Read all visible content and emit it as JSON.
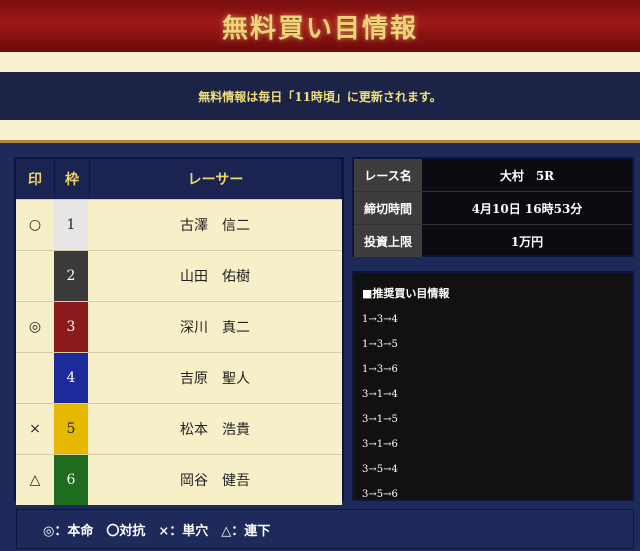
{
  "banner": {
    "title": "無料買い目情報"
  },
  "notice": {
    "text": "無料情報は毎日「11時頃」に更新されます。"
  },
  "table": {
    "headers": {
      "mark": "印",
      "frame": "枠",
      "racer": "レーサー"
    },
    "rows": [
      {
        "mark": "○",
        "frame": "1",
        "name": "古澤　信二",
        "color": "#e6e6e6",
        "text_color": "#222"
      },
      {
        "mark": "",
        "frame": "2",
        "name": "山田　佑樹",
        "color": "#3a3a3a",
        "text_color": "#fff"
      },
      {
        "mark": "◎",
        "frame": "3",
        "name": "深川　真二",
        "color": "#8b1a1a",
        "text_color": "#fff"
      },
      {
        "mark": "",
        "frame": "4",
        "name": "吉原　聖人",
        "color": "#1d2b9a",
        "text_color": "#fff"
      },
      {
        "mark": "×",
        "frame": "5",
        "name": "松本　浩貴",
        "color": "#e6b800",
        "text_color": "#222"
      },
      {
        "mark": "△",
        "frame": "6",
        "name": "岡谷　健吾",
        "color": "#1f6b1f",
        "text_color": "#fff"
      }
    ]
  },
  "info": {
    "rows": [
      {
        "label": "レース名",
        "value": "大村　5R"
      },
      {
        "label": "締切時間",
        "value": "4月10日 16時53分"
      },
      {
        "label": "投資上限",
        "value": "1万円"
      }
    ]
  },
  "picks": {
    "title": "■推奨買い目情報",
    "lines": [
      "1→3→4",
      "1→3→5",
      "1→3→6",
      "3→1→4",
      "3→1→5",
      "3→1→6",
      "3→5→4",
      "3→5→6"
    ]
  },
  "legend": {
    "text": "◎：本命　〇対抗　×：単穴　△：連下"
  }
}
